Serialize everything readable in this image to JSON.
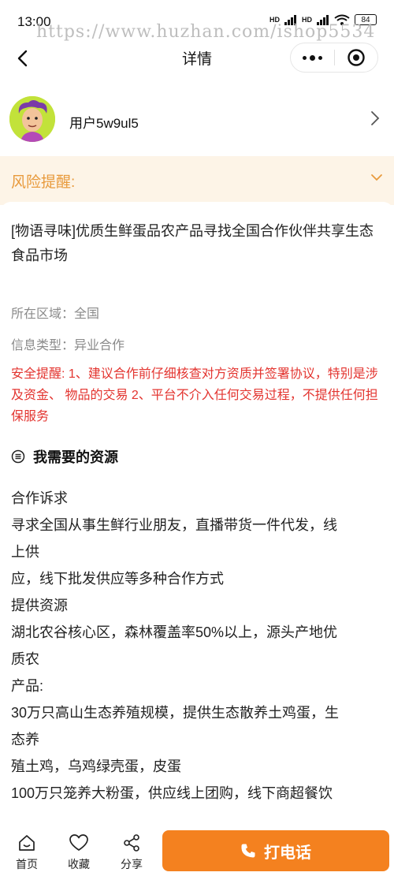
{
  "status_bar": {
    "time": "13:00",
    "signal_1": "HD",
    "signal_2": "HD",
    "battery": "84"
  },
  "watermark": "https://www.huzhan.com/ishop5534",
  "nav": {
    "title": "详情"
  },
  "user": {
    "name": "用户5w9ul5"
  },
  "risk": {
    "label": "风险提醒:"
  },
  "post": {
    "title": "[物语寻味]优质生鲜蛋品农产品寻找全国合作伙伴共享生态食品市场",
    "region": "所在区域：全国",
    "info_type": "信息类型：异业合作",
    "warning": "安全提醒: 1、建议合作前仔细核查对方资质并签署协议，特别是涉及资金、 物品的交易 2、平台不介入任何交易过程，不提供任何担保服务"
  },
  "section": {
    "title": "我需要的资源"
  },
  "body_lines": [
    "合作诉求",
    "寻求全国从事生鲜行业朋友，直播带货一件代发，线",
    "上供",
    "应，线下批发供应等多种合作方式",
    "提供资源",
    "湖北农谷核心区，森林覆盖率50%以上，源头产地优",
    "质农",
    "产品:",
    "30万只高山生态养殖规模，提供生态散养土鸡蛋，生",
    "态养",
    "殖土鸡，乌鸡绿壳蛋，皮蛋",
    "100万只笼养大粉蛋，供应线上团购，线下商超餐饮"
  ],
  "tabbar": {
    "home": "首页",
    "favorite": "收藏",
    "share": "分享",
    "call": "打电话"
  },
  "colors": {
    "accent": "#f4811f",
    "risk_bg": "#fdf4e7",
    "risk_text": "#e89a3c",
    "warning_text": "#e3342f"
  }
}
